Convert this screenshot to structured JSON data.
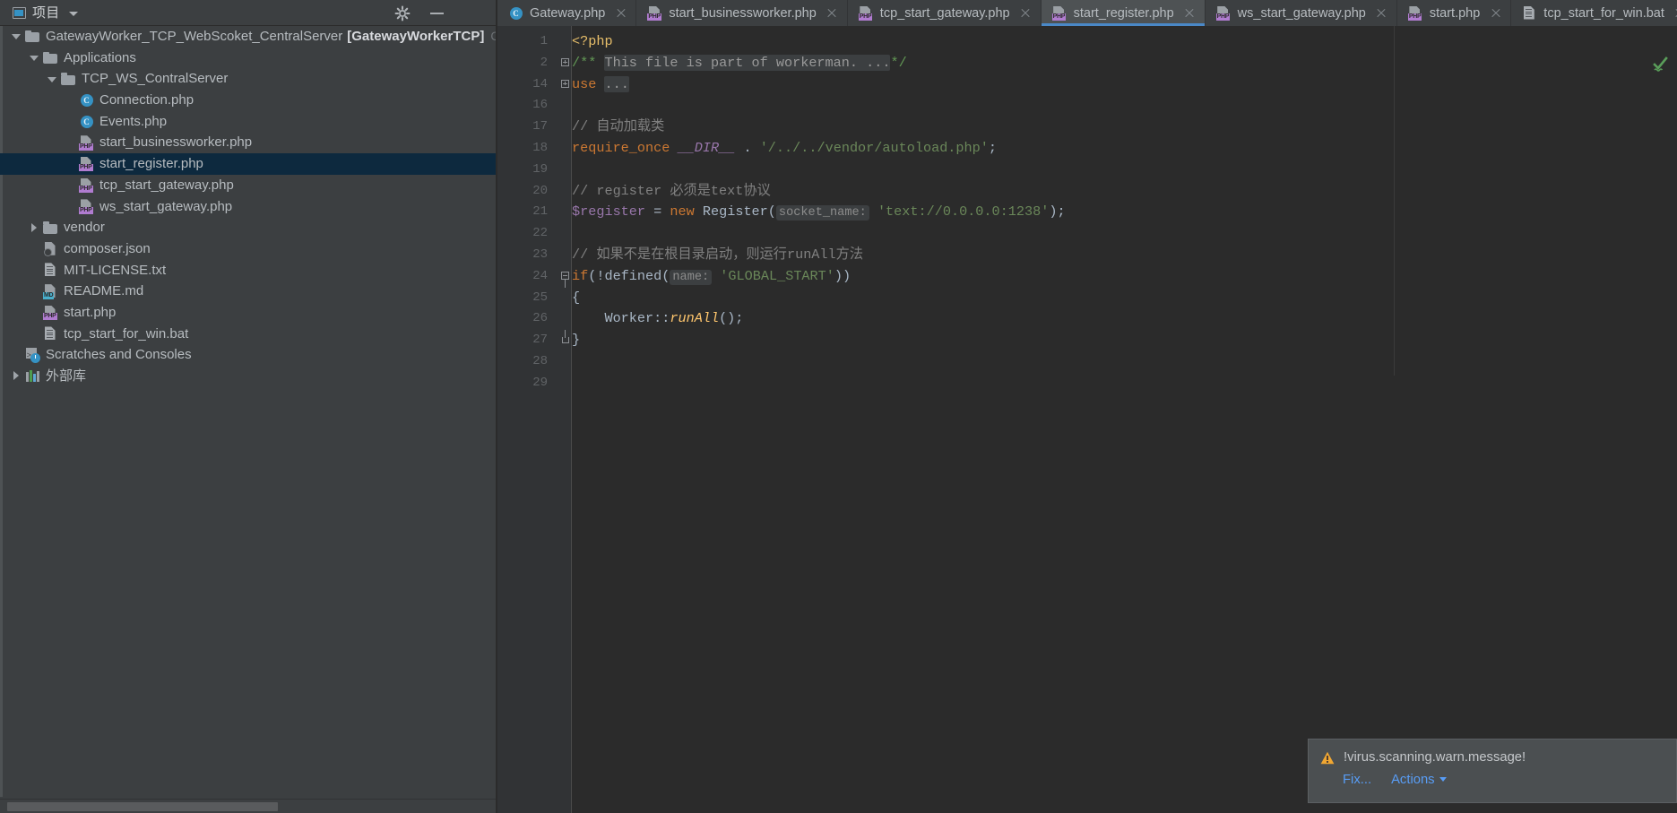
{
  "project_panel": {
    "title": "项目",
    "toolbar": {
      "settings_icon": "gear-icon",
      "minimize_icon": "minimize-icon",
      "dropdown_icon": "chevron-down-icon"
    },
    "tree": [
      {
        "label": "GatewayWorker_TCP_WebScoket_CentralServer",
        "module": "[GatewayWorkerTCP]",
        "path": "C:\\U",
        "icon": "folder-icon",
        "twisty": "open",
        "indent": 0,
        "selected": false
      },
      {
        "label": "Applications",
        "icon": "folder-icon",
        "twisty": "open",
        "indent": 1,
        "selected": false
      },
      {
        "label": "TCP_WS_ContralServer",
        "icon": "folder-icon",
        "twisty": "open",
        "indent": 2,
        "selected": false
      },
      {
        "label": "Connection.php",
        "icon": "php-class-icon",
        "twisty": "none",
        "indent": 3,
        "selected": false
      },
      {
        "label": "Events.php",
        "icon": "php-class-icon",
        "twisty": "none",
        "indent": 3,
        "selected": false
      },
      {
        "label": "start_businessworker.php",
        "icon": "php-file-icon",
        "twisty": "none",
        "indent": 3,
        "selected": false
      },
      {
        "label": "start_register.php",
        "icon": "php-file-icon",
        "twisty": "none",
        "indent": 3,
        "selected": true
      },
      {
        "label": "tcp_start_gateway.php",
        "icon": "php-file-icon",
        "twisty": "none",
        "indent": 3,
        "selected": false
      },
      {
        "label": "ws_start_gateway.php",
        "icon": "php-file-icon",
        "twisty": "none",
        "indent": 3,
        "selected": false
      },
      {
        "label": "vendor",
        "icon": "folder-icon",
        "twisty": "closed",
        "indent": 1,
        "selected": false
      },
      {
        "label": "composer.json",
        "icon": "json-file-icon",
        "twisty": "none",
        "indent": 1,
        "selected": false
      },
      {
        "label": "MIT-LICENSE.txt",
        "icon": "text-file-icon",
        "twisty": "none",
        "indent": 1,
        "selected": false
      },
      {
        "label": "README.md",
        "icon": "markdown-file-icon",
        "twisty": "none",
        "indent": 1,
        "selected": false
      },
      {
        "label": "start.php",
        "icon": "php-file-icon",
        "twisty": "none",
        "indent": 1,
        "selected": false
      },
      {
        "label": "tcp_start_for_win.bat",
        "icon": "bat-file-icon",
        "twisty": "none",
        "indent": 1,
        "selected": false
      },
      {
        "label": "Scratches and Consoles",
        "icon": "scratches-icon",
        "twisty": "none",
        "indent": 0,
        "selected": false
      },
      {
        "label": "外部库",
        "icon": "external-libraries-icon",
        "twisty": "closed",
        "indent": 0,
        "selected": false
      }
    ]
  },
  "tabs": [
    {
      "label": "Gateway.php",
      "icon": "php-class-icon",
      "active": false
    },
    {
      "label": "start_businessworker.php",
      "icon": "php-file-icon",
      "active": false
    },
    {
      "label": "tcp_start_gateway.php",
      "icon": "php-file-icon",
      "active": false
    },
    {
      "label": "start_register.php",
      "icon": "php-file-icon",
      "active": true
    },
    {
      "label": "ws_start_gateway.php",
      "icon": "php-file-icon",
      "active": false
    },
    {
      "label": "start.php",
      "icon": "php-file-icon",
      "active": false
    },
    {
      "label": "tcp_start_for_win.bat",
      "icon": "bat-file-icon",
      "active": false
    }
  ],
  "editor": {
    "active_file": "start_register.php",
    "inspection_status": "check-icon",
    "line_numbers": [
      "1",
      "2",
      "14",
      "16",
      "17",
      "18",
      "19",
      "20",
      "21",
      "22",
      "23",
      "24",
      "25",
      "26",
      "27",
      "28",
      "29"
    ],
    "lines": [
      {
        "n": "1",
        "fold": "none",
        "text": "<?php"
      },
      {
        "n": "2",
        "fold": "plus",
        "text": "/** This file is part of workerman. ...*/"
      },
      {
        "n": "14",
        "fold": "plus",
        "text": "use ..."
      },
      {
        "n": "16",
        "fold": "none",
        "text": ""
      },
      {
        "n": "17",
        "fold": "none",
        "text": "// 自动加载类"
      },
      {
        "n": "18",
        "fold": "none",
        "text": "require_once __DIR__ . '/../../vendor/autoload.php';"
      },
      {
        "n": "19",
        "fold": "none",
        "text": ""
      },
      {
        "n": "20",
        "fold": "none",
        "text": "// register 必须是text协议"
      },
      {
        "n": "21",
        "fold": "none",
        "text": "$register = new Register( socket_name: 'text://0.0.0.0:1238');"
      },
      {
        "n": "22",
        "fold": "none",
        "text": ""
      },
      {
        "n": "23",
        "fold": "none",
        "text": "// 如果不是在根目录启动，则运行runAll方法"
      },
      {
        "n": "24",
        "fold": "minus",
        "text": "if(!defined( name: 'GLOBAL_START'))"
      },
      {
        "n": "25",
        "fold": "none",
        "text": "{"
      },
      {
        "n": "26",
        "fold": "none",
        "text": "    Worker::runAll();"
      },
      {
        "n": "27",
        "fold": "end",
        "text": "}"
      },
      {
        "n": "28",
        "fold": "none",
        "text": ""
      },
      {
        "n": "29",
        "fold": "none",
        "text": ""
      }
    ],
    "param_hints": [
      "socket_name:",
      "name:"
    ],
    "folded_placeholders": [
      "This file is part of workerman. ...",
      "..."
    ]
  },
  "notification": {
    "icon": "warning-icon",
    "message": "!virus.scanning.warn.message!",
    "fix_label": "Fix...",
    "actions_label": "Actions",
    "actions_caret": "chevron-down-icon"
  },
  "colors": {
    "panel_bg": "#3c3f41",
    "editor_bg": "#2b2b2b",
    "gutter_bg": "#313335",
    "selection_bg": "#0d293e",
    "active_tab_bg": "#4e5254",
    "active_tab_underline": "#4a88c7",
    "link_blue": "#589df6",
    "warn_orange": "#f0a732",
    "string_green": "#6a8759",
    "keyword_orange": "#cc7832",
    "comment_green": "#629755",
    "variable_purple": "#9876aa",
    "method_yellow": "#ffc66d",
    "check_green": "#5a9e5a"
  }
}
